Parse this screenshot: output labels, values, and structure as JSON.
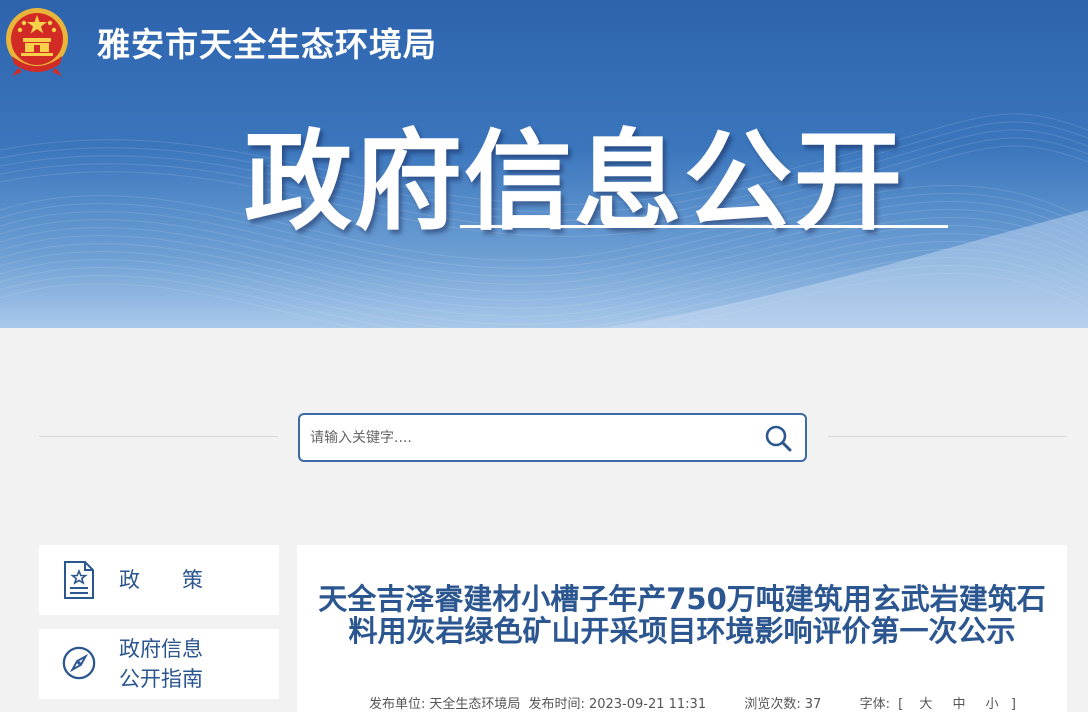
{
  "header": {
    "site_name": "雅安市天全生态环境局",
    "banner_title": "政府信息公开"
  },
  "search": {
    "placeholder": "请输入关键字...."
  },
  "sidebar": {
    "items": [
      {
        "label": "政　　策",
        "icon": "policy-document-icon"
      },
      {
        "label_line1": "政府信息",
        "label_line2": "公开指南",
        "icon": "compass-icon"
      }
    ]
  },
  "article": {
    "title": "天全吉泽睿建材小槽子年产750万吨建筑用玄武岩建筑石料用灰岩绿色矿山开采项目环境影响评价第一次公示",
    "meta": {
      "publisher_label": "发布单位:",
      "publisher": "天全生态环境局",
      "time_label": "发布时间:",
      "time": "2023-09-21 11:31",
      "views_label": "浏览次数:",
      "views": "37",
      "font_label": "字体:",
      "bracket_open": "[",
      "font_large": "大",
      "font_medium": "中",
      "font_small": "小",
      "bracket_close": "]"
    }
  },
  "colors": {
    "brand_blue": "#2b5690",
    "banner_top": "#2d63ad",
    "search_border": "#3b6aa5"
  }
}
